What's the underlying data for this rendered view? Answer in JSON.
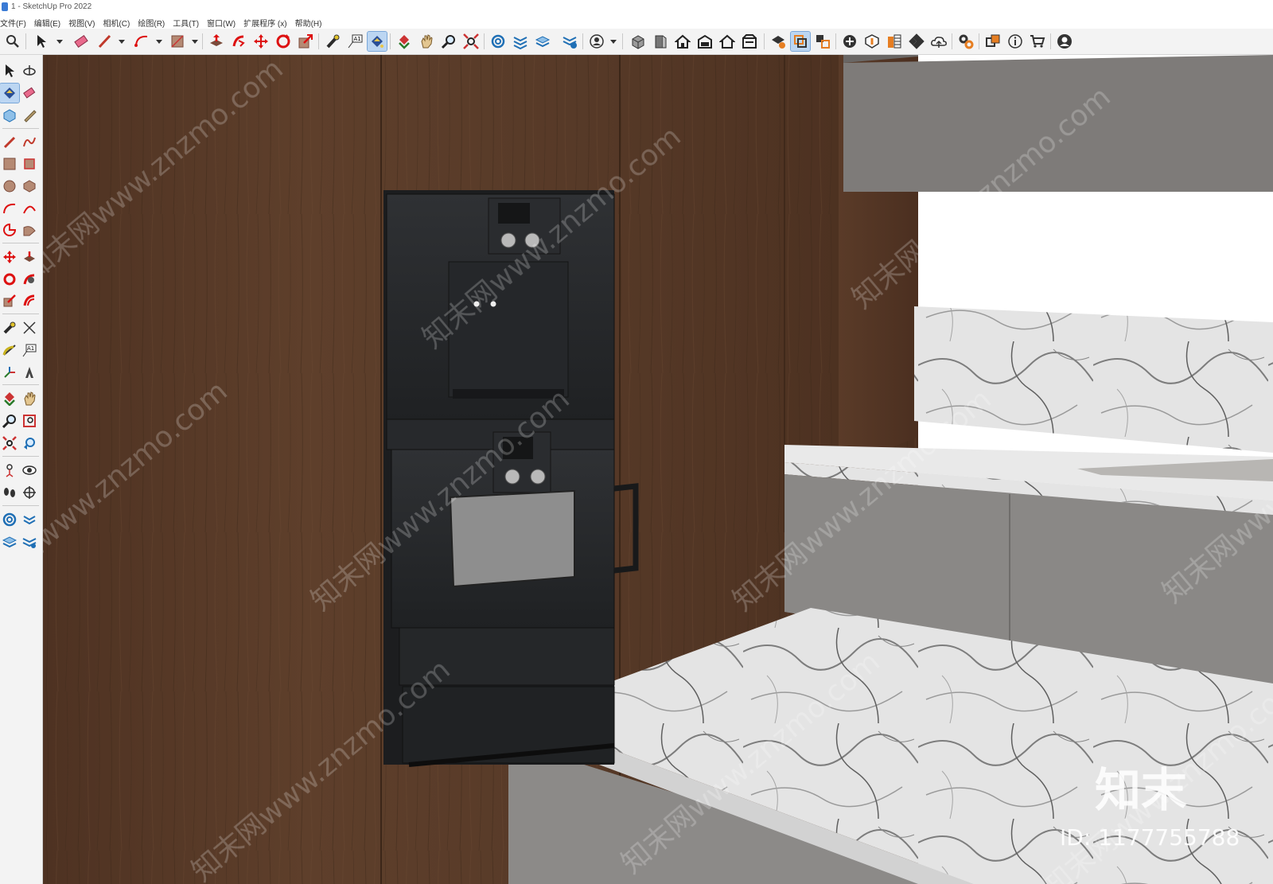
{
  "window": {
    "title": "1 - SketchUp Pro 2022"
  },
  "menubar": {
    "items": [
      "文件(F)",
      "编辑(E)",
      "视图(V)",
      "相机(C)",
      "绘图(R)",
      "工具(T)",
      "窗口(W)",
      "扩展程序 (x)",
      "帮助(H)"
    ]
  },
  "toolbar": {
    "icons": [
      "search-icon",
      "select-arrow-icon",
      "eraser-icon",
      "pencil-line-icon",
      "arc-icon",
      "rectangle-icon",
      "push-pull-icon",
      "follow-me-icon",
      "move-icon",
      "rotate-icon",
      "scale-icon",
      "tape-measure-icon",
      "text-label-icon",
      "paint-bucket-icon",
      "orbit-icon",
      "pan-icon",
      "zoom-icon",
      "zoom-extents-icon",
      "sandbox-icon",
      "layers-icon",
      "outliner-icon",
      "model-info-icon",
      "user-avatar-icon",
      "iso-view-icon",
      "front-view-icon",
      "home-view-icon",
      "top-view-icon",
      "right-view-icon",
      "back-view-icon",
      "section-plane-icon",
      "display-section-icon",
      "section-cut-icon",
      "add-location-icon",
      "shadow-icon",
      "style-builder-icon",
      "checkerboard-icon",
      "cloud-icon",
      "extension-manager-icon",
      "component-icon",
      "info-icon",
      "cart-icon",
      "account-icon"
    ],
    "active_tool": "paint-bucket-icon"
  },
  "left_toolbar": {
    "icons": [
      "select-icon",
      "orbit-small-icon",
      "paint-bucket-icon",
      "eraser-icon",
      "component-icon",
      "tape-icon",
      "line-icon",
      "freehand-icon",
      "rectangle-icon",
      "rotated-rect-icon",
      "circle-icon",
      "polygon-icon",
      "arc-icon",
      "two-point-arc-icon",
      "pie-icon",
      "three-point-arc-icon",
      "move-icon",
      "push-pull-icon",
      "rotate-icon",
      "follow-me-icon",
      "scale-icon",
      "offset-icon",
      "tape-measure-icon",
      "dimension-icon",
      "protractor-icon",
      "text-icon",
      "axes-icon",
      "3d-text-icon",
      "orbit-icon",
      "pan-icon",
      "zoom-icon",
      "zoom-window-icon",
      "zoom-extents-icon",
      "previous-view-icon",
      "position-camera-icon",
      "look-around-icon",
      "walk-icon",
      "section-plane-icon",
      "sandbox-from-contours-icon",
      "sandbox-from-scratch-icon",
      "smoove-icon",
      "stamp-icon"
    ]
  },
  "watermark": {
    "site_text": "知末网www.znzmo.com",
    "logo_text": "知末",
    "id_text": "ID: 1177755788"
  },
  "colors": {
    "wood": "#5c3d2a",
    "oven_body": "#2b2d30",
    "oven_window": "#8e8e8e",
    "cabinet_gray": "#8a8886",
    "marble": "#dedede",
    "selection_blue": "#bcd6f2"
  }
}
